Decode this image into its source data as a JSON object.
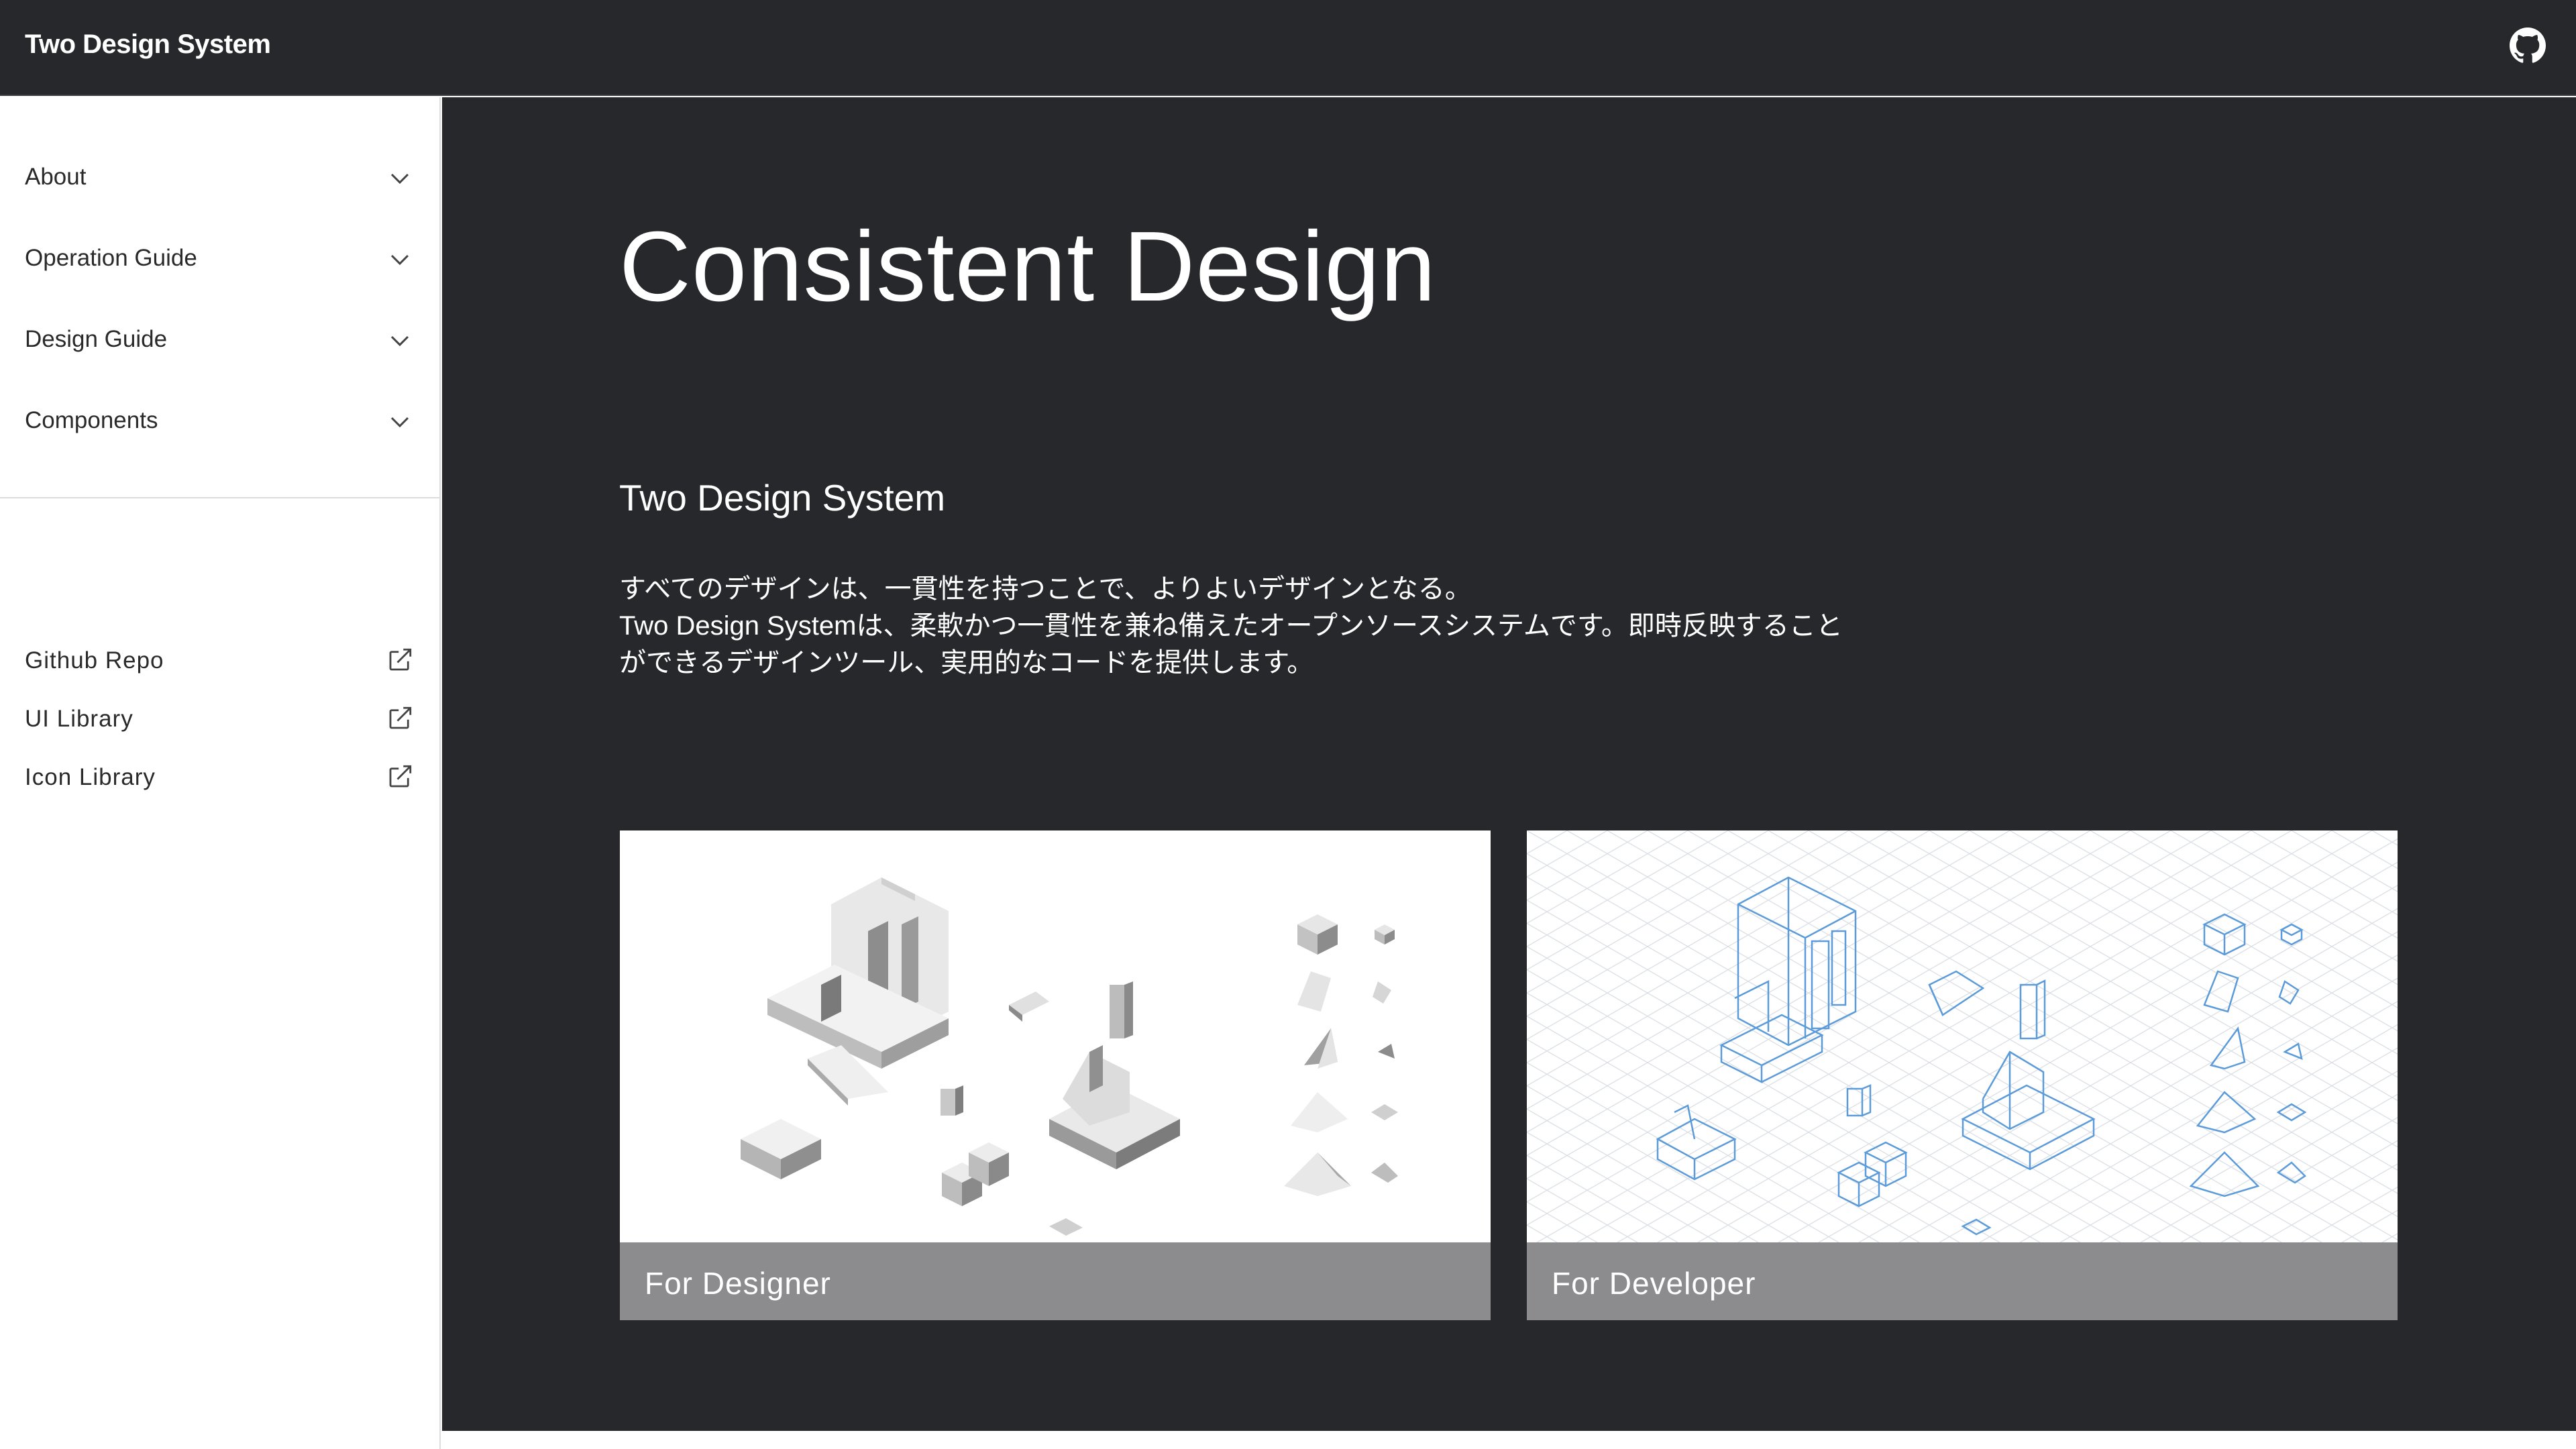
{
  "header": {
    "brand": "Two Design System",
    "github_icon": "github-icon"
  },
  "sidebar": {
    "nav": [
      {
        "label": "About",
        "icon": "chevron-down-icon"
      },
      {
        "label": "Operation Guide",
        "icon": "chevron-down-icon"
      },
      {
        "label": "Design Guide",
        "icon": "chevron-down-icon"
      },
      {
        "label": "Components",
        "icon": "chevron-down-icon"
      }
    ],
    "links": [
      {
        "label": "Github Repo",
        "icon": "external-link-icon"
      },
      {
        "label": "UI Library",
        "icon": "external-link-icon"
      },
      {
        "label": "Icon Library",
        "icon": "external-link-icon"
      }
    ]
  },
  "main": {
    "hero_title": "Consistent Design",
    "subtitle": "Two Design System",
    "description": [
      "すべてのデザインは、一貫性を持つことで、よりよいデザインとなる。",
      "Two Design Systemは、柔軟かつ一貫性を兼ね備えたオープンソースシステムです。即時反映すること",
      "ができるデザインツール、実用的なコードを提供します。"
    ],
    "cards": [
      {
        "label": "For Designer"
      },
      {
        "label": "For Developer"
      }
    ]
  },
  "colors": {
    "dark_bg": "#27282c",
    "card_label_bg": "#8c8c8e",
    "line_art_blue": "#5b9bd9"
  }
}
